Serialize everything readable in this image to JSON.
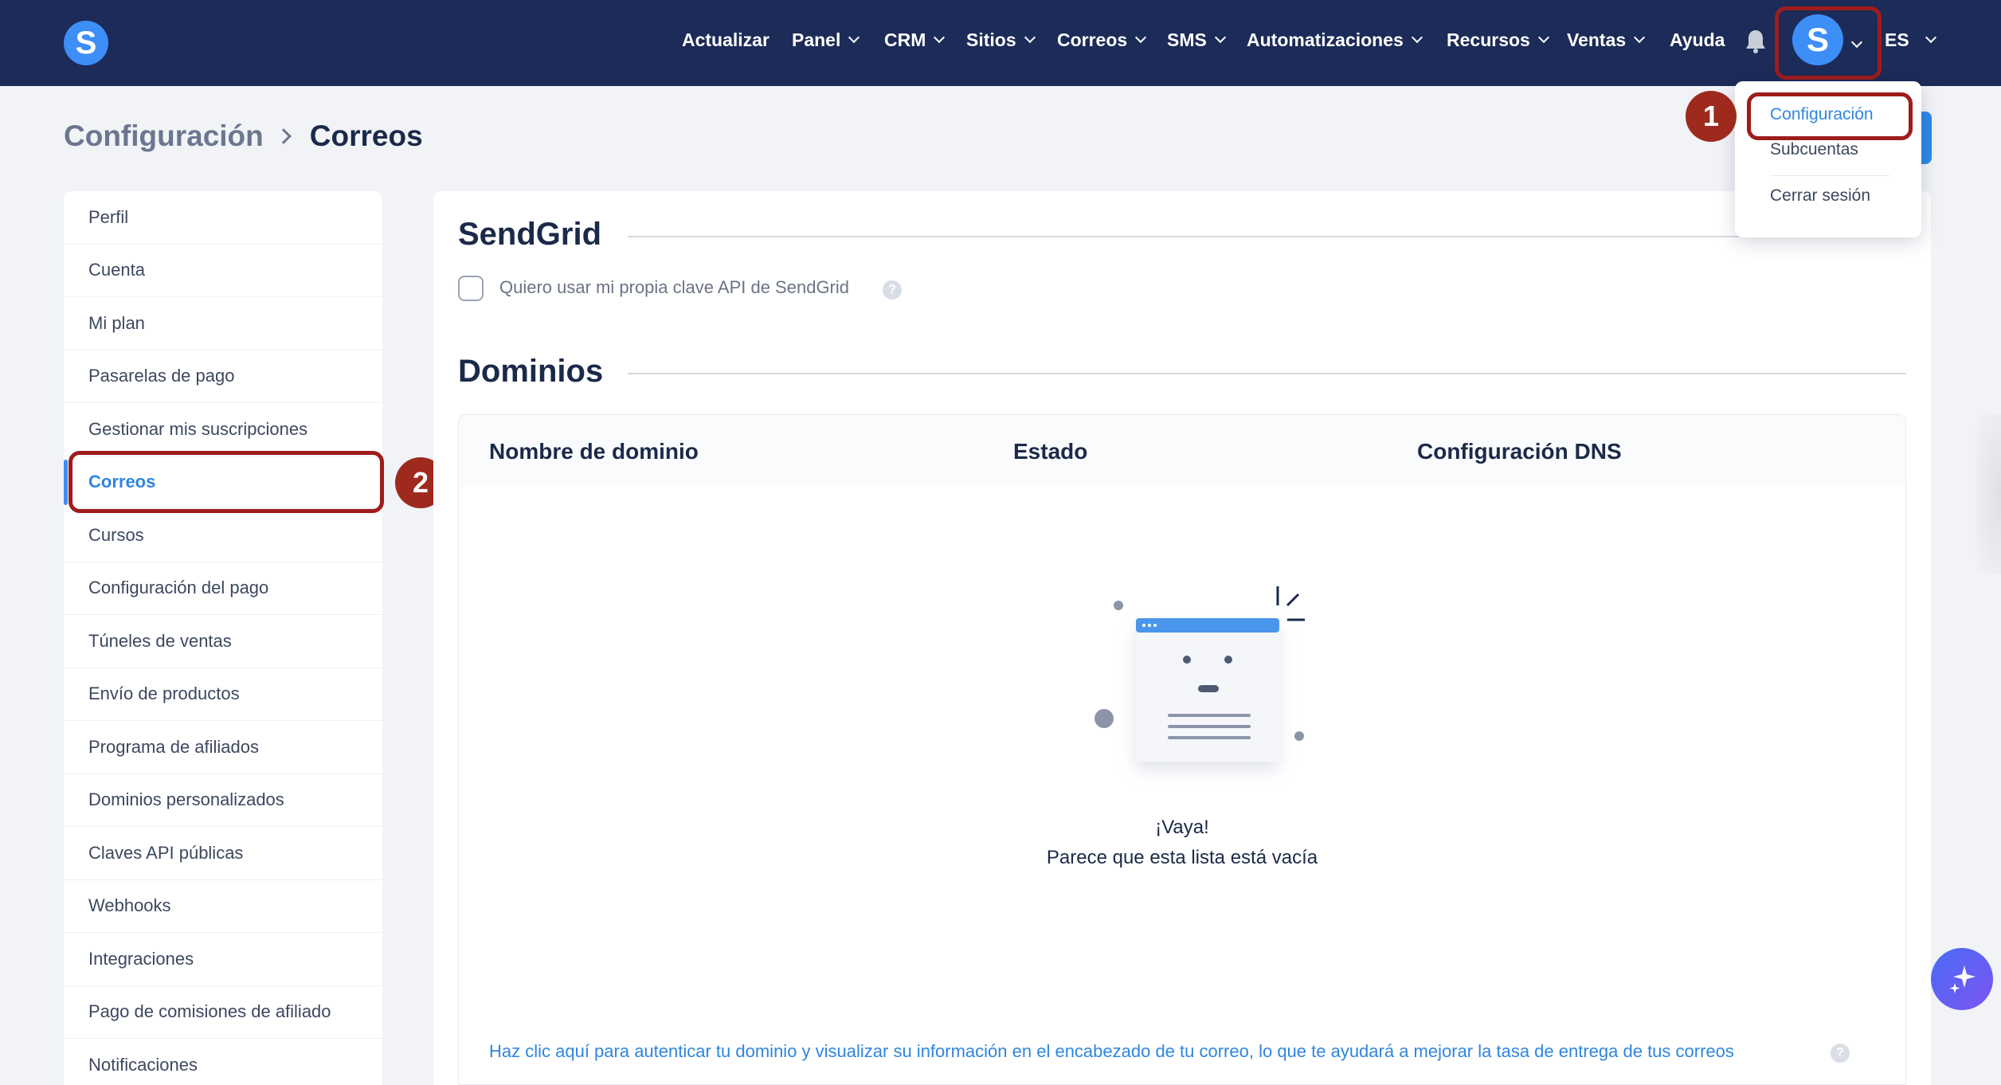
{
  "topbar": {
    "logo_letter": "S",
    "nav": [
      "Actualizar",
      "Panel",
      "CRM",
      "Sitios",
      "Correos",
      "SMS",
      "Automatizaciones",
      "Recursos",
      "Ventas",
      "Ayuda"
    ],
    "avatar_letter": "S",
    "language": "ES"
  },
  "breadcrumb": {
    "parent": "Configuración",
    "current": "Correos"
  },
  "dropdown": {
    "items": [
      "Configuración",
      "Subcuentas",
      "Cerrar sesión"
    ],
    "active": "Configuración"
  },
  "annotations": {
    "step1": "1",
    "step2": "2"
  },
  "sidebar": {
    "items": [
      "Perfil",
      "Cuenta",
      "Mi plan",
      "Pasarelas de pago",
      "Gestionar mis suscripciones",
      "Correos",
      "Cursos",
      "Configuración del pago",
      "Túneles de ventas",
      "Envío de productos",
      "Programa de afiliados",
      "Dominios personalizados",
      "Claves API públicas",
      "Webhooks",
      "Integraciones",
      "Pago de comisiones de afiliado",
      "Notificaciones"
    ],
    "active": "Correos"
  },
  "sendgrid": {
    "title": "SendGrid",
    "checkbox_label": "Quiero usar mi propia clave API de SendGrid",
    "checked": false,
    "help": "?"
  },
  "domains": {
    "title": "Dominios",
    "columns": [
      "Nombre de dominio",
      "Estado",
      "Configuración DNS"
    ],
    "empty_title": "¡Vaya!",
    "empty_subtitle": "Parece que esta lista está vacía",
    "footer_link": "Haz clic aquí para autenticar tu dominio y visualizar su información en el encabezado de tu correo, lo que te ayudará a mejorar la tasa de entrega de tus correos",
    "help": "?"
  },
  "colors": {
    "topbar": "#1c2b58",
    "accent": "#3d8ef7",
    "link": "#2f86de",
    "highlight": "#9e1c1b"
  },
  "icons": [
    "bell-icon",
    "chevron-down-icon",
    "help-icon",
    "sparkle-icon",
    "empty-list-illustration"
  ]
}
